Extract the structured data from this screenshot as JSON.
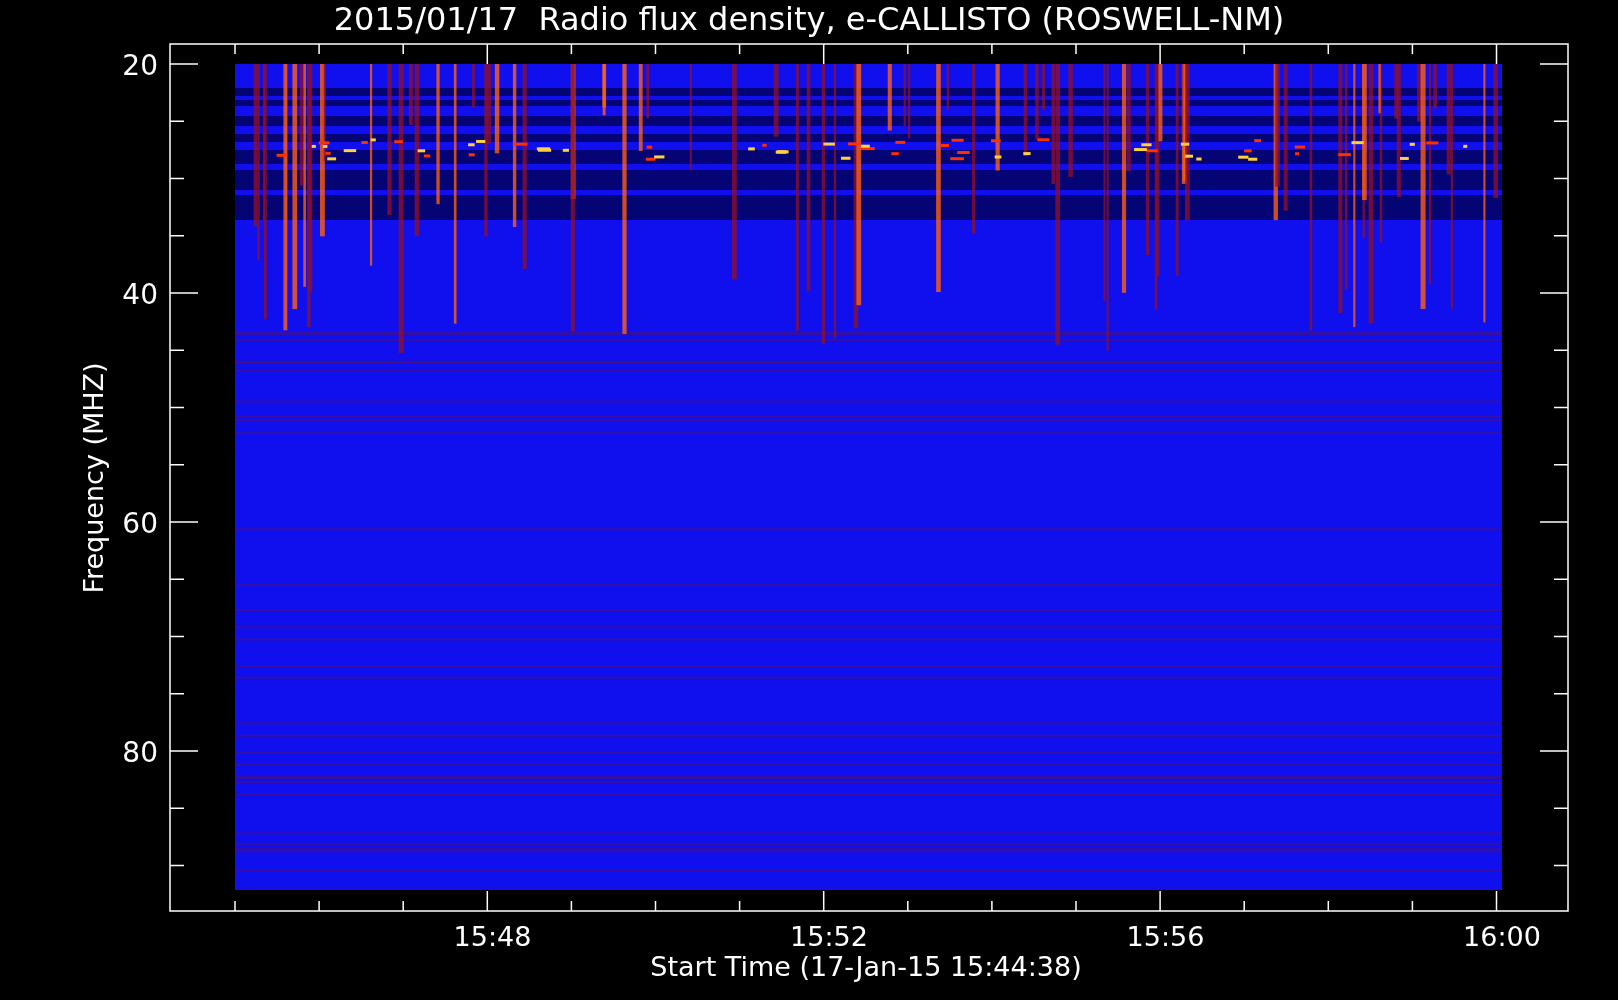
{
  "title": "2015/01/17  Radio flux density, e-CALLISTO (ROSWELL-NM)",
  "y_axis": {
    "label": "Frequency (MHZ)",
    "ticks": [
      "20",
      "40",
      "60",
      "80"
    ]
  },
  "x_axis": {
    "label": "Start Time (17-Jan-15 15:44:38)",
    "ticks": [
      "15:48",
      "15:52",
      "15:56",
      "16:00"
    ]
  }
}
